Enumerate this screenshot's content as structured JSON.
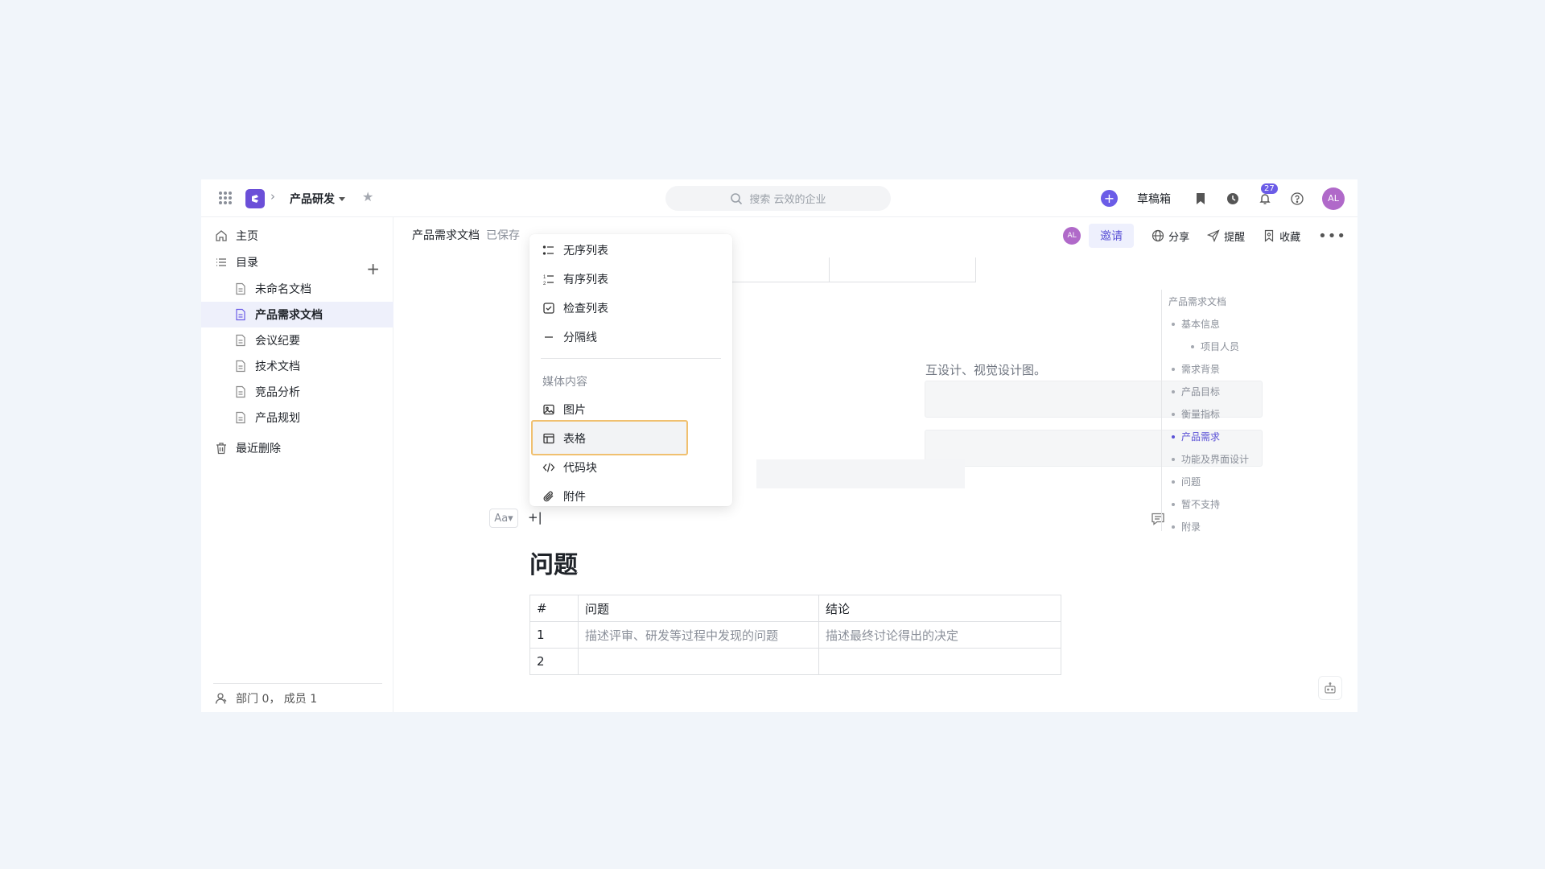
{
  "topbar": {
    "workspace": "产品研发",
    "search_placeholder": "搜索 云效的企业",
    "drafts_label": "草稿箱",
    "notification_count": "27",
    "avatar_initials": "AL"
  },
  "sidebar": {
    "home": "主页",
    "catalog": "目录",
    "docs": [
      "未命名文档",
      "产品需求文档",
      "会议纪要",
      "技术文档",
      "竞品分析",
      "产品规划"
    ],
    "active_doc_index": 1,
    "trash": "最近删除",
    "footer": "部门 0， 成员 1"
  },
  "doc_header": {
    "title": "产品需求文档",
    "status": "已保存",
    "avatar_initials": "AL",
    "invite": "邀请",
    "share": "分享",
    "remind": "提醒",
    "favorite": "收藏"
  },
  "content": {
    "hint_text": "互设计、视觉设计图。",
    "format_button": "Aa",
    "cursor_text": "+|",
    "heading": "问题",
    "table": {
      "headers": [
        "#",
        "问题",
        "结论"
      ],
      "rows": [
        [
          "1",
          "描述评审、研发等过程中发现的问题",
          "描述最终讨论得出的决定"
        ],
        [
          "2",
          "",
          ""
        ]
      ]
    }
  },
  "toc": {
    "title": "产品需求文档",
    "items": [
      {
        "label": "基本信息",
        "level": 1
      },
      {
        "label": "项目人员",
        "level": 2
      },
      {
        "label": "需求背景",
        "level": 1
      },
      {
        "label": "产品目标",
        "level": 1
      },
      {
        "label": "衡量指标",
        "level": 1
      },
      {
        "label": "产品需求",
        "level": 1,
        "active": true
      },
      {
        "label": "功能及界面设计",
        "level": 1
      },
      {
        "label": "问题",
        "level": 1
      },
      {
        "label": "暂不支持",
        "level": 1
      },
      {
        "label": "附录",
        "level": 1
      }
    ]
  },
  "insert_menu": {
    "list_items": [
      "无序列表",
      "有序列表",
      "检查列表",
      "分隔线"
    ],
    "media_group": "媒体内容",
    "media_items": [
      "图片",
      "表格",
      "代码块",
      "附件"
    ],
    "highlighted": "表格"
  },
  "colors": {
    "brand": "#6b4fd8",
    "accent": "#5b52d6",
    "avatar": "#b069c9",
    "focus_outline": "#f0c070"
  }
}
